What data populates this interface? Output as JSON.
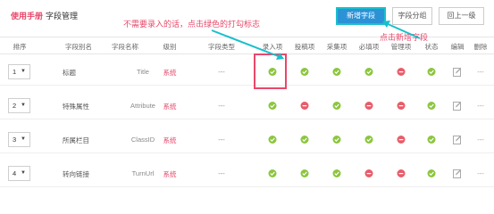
{
  "header": {
    "manual_link": "使用手册",
    "title": "字段管理",
    "add_button": "新增字段",
    "group_button": "字段分组",
    "back_button": "回上一级"
  },
  "annotations": {
    "note_checkmark": "不需要录入的话，点击绿色的打勾标志",
    "note_add": "点击新增字段"
  },
  "columns": [
    "排序",
    "字段别名",
    "字段名称",
    "级别",
    "字段类型",
    "录入项",
    "投稿项",
    "采集项",
    "必填项",
    "管理项",
    "状态",
    "编辑",
    "删除"
  ],
  "rows": [
    {
      "sort": "1",
      "alias": "标题",
      "name": "Title",
      "level": "系统",
      "type": "---",
      "flags": [
        "ok",
        "ok",
        "ok",
        "ok",
        "no",
        "ok"
      ],
      "delete": "---"
    },
    {
      "sort": "2",
      "alias": "特殊属性",
      "name": "Attribute",
      "level": "系统",
      "type": "---",
      "flags": [
        "ok",
        "no",
        "ok",
        "no",
        "no",
        "ok"
      ],
      "delete": "---"
    },
    {
      "sort": "3",
      "alias": "所属栏目",
      "name": "ClassID",
      "level": "系统",
      "type": "---",
      "flags": [
        "ok",
        "ok",
        "ok",
        "ok",
        "no",
        "ok"
      ],
      "delete": "---"
    },
    {
      "sort": "4",
      "alias": "转向链接",
      "name": "TurnUrl",
      "level": "系统",
      "type": "---",
      "flags": [
        "ok",
        "ok",
        "ok",
        "no",
        "no",
        "ok"
      ],
      "delete": "---"
    }
  ],
  "icons": {
    "ok": "check-circle-icon",
    "no": "minus-circle-icon",
    "edit": "edit-icon",
    "caret": "caret-down-icon"
  },
  "colors": {
    "ok": "#8cc63e",
    "no": "#e85d6a",
    "accent": "#e8486a",
    "primary": "#2c92d6",
    "annotation_arrow": "#18c0cc"
  }
}
